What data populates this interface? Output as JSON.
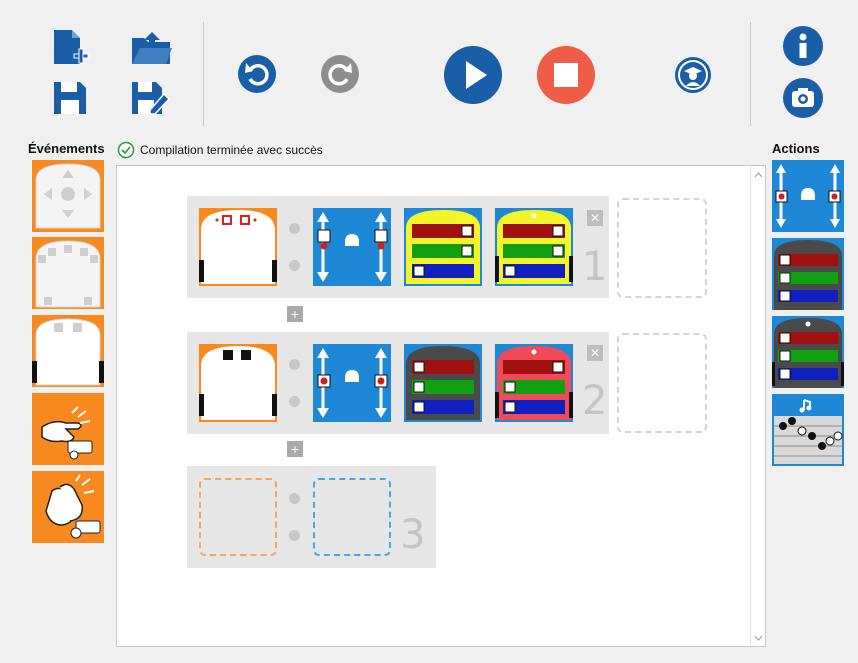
{
  "toolbar": {
    "buttons": [
      {
        "name": "new-file",
        "icon": "new-file-icon"
      },
      {
        "name": "open-file",
        "icon": "open-folder-icon"
      },
      {
        "name": "save",
        "icon": "save-icon"
      },
      {
        "name": "save-as",
        "icon": "save-as-icon"
      },
      {
        "name": "undo",
        "icon": "undo-icon"
      },
      {
        "name": "redo",
        "icon": "redo-icon"
      },
      {
        "name": "run",
        "icon": "play-icon"
      },
      {
        "name": "stop",
        "icon": "stop-icon"
      },
      {
        "name": "teacher-mode",
        "icon": "graduate-icon"
      },
      {
        "name": "info",
        "icon": "info-icon"
      },
      {
        "name": "screenshot",
        "icon": "camera-icon"
      }
    ]
  },
  "colors": {
    "primary_blue": "#1a5ea8",
    "stop_red": "#ef5d47",
    "grey_button": "#8e8e8e",
    "orange": "#f7891f",
    "action_blue": "#1f88d6",
    "success_green": "#2e9b3a"
  },
  "events_panel": {
    "label": "Événements",
    "tiles": [
      "buttons-event",
      "front-sensors-event",
      "ground-sensors-event",
      "tap-event",
      "clap-event"
    ]
  },
  "status": {
    "icon": "check-circle-icon",
    "text": "Compilation terminée avec succès"
  },
  "actions_panel": {
    "label": "Actions",
    "tiles": [
      "motors-action",
      "top-color-action",
      "bottom-color-action",
      "music-action"
    ]
  },
  "workspace": {
    "rows": [
      {
        "number": "1",
        "event": "front-sensors",
        "actions": [
          "motors",
          "top-color-yellow",
          "bottom-color-yellow"
        ]
      },
      {
        "number": "2",
        "event": "ground-sensors",
        "actions": [
          "motors",
          "top-color-dark",
          "bottom-color-red"
        ]
      },
      {
        "number": "3",
        "event": "empty",
        "actions": []
      }
    ],
    "add_label": "+",
    "remove_label": "✕"
  }
}
